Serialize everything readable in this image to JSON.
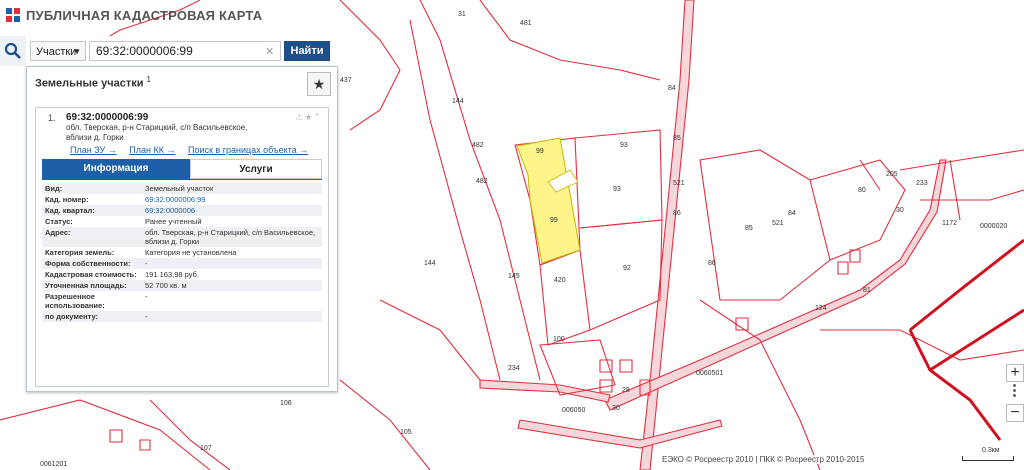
{
  "header": {
    "title": "ПУБЛИЧНАЯ КАДАСТРОВАЯ КАРТА"
  },
  "search": {
    "scope": "Участки",
    "query": "69:32:0000006:99",
    "button": "Найти"
  },
  "panel": {
    "title": "Земельные участки",
    "count": "1",
    "result": {
      "index": "1.",
      "id": "69:32:0000006:99",
      "address": "обл. Тверская, р-н Старицкий, с/п Васильевское, вблизи д. Горки",
      "links": [
        "План ЗУ →",
        "План КК →",
        "Поиск в границах объекта →"
      ],
      "tabs": [
        "Информация",
        "Услуги"
      ],
      "attributes": [
        {
          "key": "Вид:",
          "value": "Земельный участок"
        },
        {
          "key": "Кад. номер:",
          "value": "69:32:0000006:99"
        },
        {
          "key": "Кад. квартал:",
          "value": "69:32:0000006"
        },
        {
          "key": "Статус:",
          "value": "Ранее учтенный"
        },
        {
          "key": "Адрес:",
          "value": "обл. Тверская, р-н Старицкий, с/п Васильевское, вблизи д. Горки"
        },
        {
          "key": "Категория земель:",
          "value": "Категория не установлена"
        },
        {
          "key": "Форма собственности:",
          "value": "-"
        },
        {
          "key": "Кадастровая стоимость:",
          "value": "191 163,98 руб."
        },
        {
          "key": "Уточненная площадь:",
          "value": "52 700 кв. м"
        },
        {
          "key": "Разрешенное использование:",
          "value": "-"
        },
        {
          "key": "по документу:",
          "value": "-"
        }
      ]
    }
  },
  "map": {
    "labels": [
      "144",
      "482",
      "482",
      "144",
      "145",
      "420",
      "100",
      "99",
      "99",
      "93",
      "93",
      "92",
      "86",
      "84",
      "85",
      "521",
      "86",
      "84",
      "85",
      "521",
      "80",
      "205",
      "233",
      "1172",
      "0000020",
      "124",
      "81",
      "30",
      "234",
      "28",
      "30",
      "006050",
      "0060501",
      "106",
      "105",
      "107",
      "0061201",
      "437",
      "481",
      "31"
    ],
    "highlight_color": "#fdf58a",
    "line_color": "#e0303f"
  },
  "footer": {
    "copyright": "ЕЭКО © Росреестр 2010 | ПКК © Росреестр 2010-2015",
    "scale": "0.3км"
  }
}
